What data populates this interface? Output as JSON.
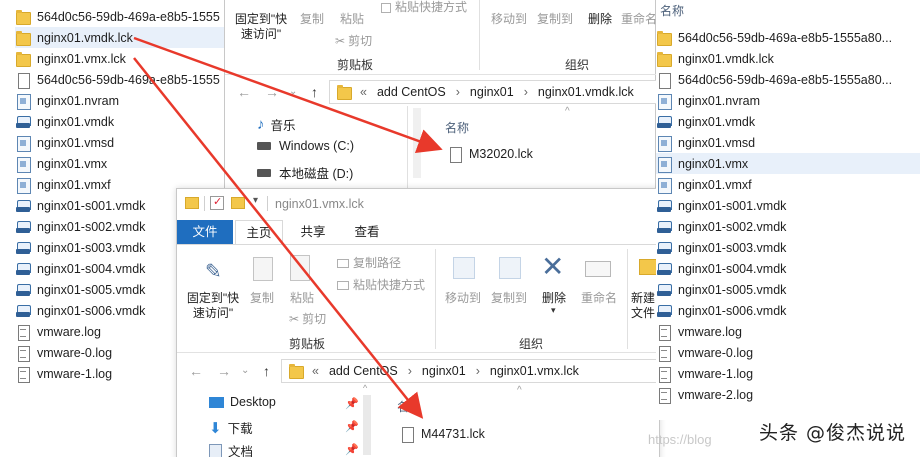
{
  "left_list": [
    {
      "name": "564d0c56-59db-469a-e8b5-1555",
      "icon": "folder"
    },
    {
      "name": "nginx01.vmdk.lck",
      "icon": "folder",
      "selected": true
    },
    {
      "name": "nginx01.vmx.lck",
      "icon": "folder"
    },
    {
      "name": "564d0c56-59db-469a-e8b5-1555",
      "icon": "doc"
    },
    {
      "name": "nginx01.nvram",
      "icon": "vmx"
    },
    {
      "name": "nginx01.vmdk",
      "icon": "disk"
    },
    {
      "name": "nginx01.vmsd",
      "icon": "vmx"
    },
    {
      "name": "nginx01.vmx",
      "icon": "vmx"
    },
    {
      "name": "nginx01.vmxf",
      "icon": "vmx"
    },
    {
      "name": "nginx01-s001.vmdk",
      "icon": "disk"
    },
    {
      "name": "nginx01-s002.vmdk",
      "icon": "disk"
    },
    {
      "name": "nginx01-s003.vmdk",
      "icon": "disk"
    },
    {
      "name": "nginx01-s004.vmdk",
      "icon": "disk"
    },
    {
      "name": "nginx01-s005.vmdk",
      "icon": "disk"
    },
    {
      "name": "nginx01-s006.vmdk",
      "icon": "disk"
    },
    {
      "name": "vmware.log",
      "icon": "docl"
    },
    {
      "name": "vmware-0.log",
      "icon": "docl"
    },
    {
      "name": "vmware-1.log",
      "icon": "docl"
    }
  ],
  "right_list": {
    "header": "名称",
    "items": [
      {
        "name": "564d0c56-59db-469a-e8b5-1555a80...",
        "icon": "folder"
      },
      {
        "name": "nginx01.vmdk.lck",
        "icon": "folder"
      },
      {
        "name": "564d0c56-59db-469a-e8b5-1555a80...",
        "icon": "doc"
      },
      {
        "name": "nginx01.nvram",
        "icon": "vmx"
      },
      {
        "name": "nginx01.vmdk",
        "icon": "disk"
      },
      {
        "name": "nginx01.vmsd",
        "icon": "vmx"
      },
      {
        "name": "nginx01.vmx",
        "icon": "vmx",
        "selected": true
      },
      {
        "name": "nginx01.vmxf",
        "icon": "vmx"
      },
      {
        "name": "nginx01-s001.vmdk",
        "icon": "disk"
      },
      {
        "name": "nginx01-s002.vmdk",
        "icon": "disk"
      },
      {
        "name": "nginx01-s003.vmdk",
        "icon": "disk"
      },
      {
        "name": "nginx01-s004.vmdk",
        "icon": "disk"
      },
      {
        "name": "nginx01-s005.vmdk",
        "icon": "disk"
      },
      {
        "name": "nginx01-s006.vmdk",
        "icon": "disk"
      },
      {
        "name": "vmware.log",
        "icon": "docl"
      },
      {
        "name": "vmware-0.log",
        "icon": "docl"
      },
      {
        "name": "vmware-1.log",
        "icon": "docl"
      },
      {
        "name": "vmware-2.log",
        "icon": "docl"
      }
    ]
  },
  "win1": {
    "ribbon": {
      "pin_label": "固定到\"快\n速访问\"",
      "copy": "复制",
      "paste": "粘贴",
      "paste_shortcut": "粘贴快捷方式",
      "cut": "剪切",
      "clipboard_group": "剪贴板",
      "move_to": "移动到",
      "copy_to": "复制到",
      "delete": "删除",
      "rename": "重命名",
      "organize_group": "组织"
    },
    "address": {
      "prefix": "«",
      "crumbs": [
        "add CentOS",
        "nginx01",
        "nginx01.vmdk.lck"
      ]
    },
    "nav": [
      {
        "label": "音乐",
        "icon": "music-icon"
      },
      {
        "label": "Windows (C:)",
        "icon": "drive-icon"
      },
      {
        "label": "本地磁盘 (D:)",
        "icon": "drive-icon"
      }
    ],
    "col_header": "名称",
    "files": [
      {
        "name": "M32020.lck"
      }
    ]
  },
  "win2": {
    "title": "nginx01.vmx.lck",
    "tabs": {
      "file": "文件",
      "home": "主页",
      "share": "共享",
      "view": "查看"
    },
    "ribbon": {
      "pin_label": "固定到\"快\n速访问\"",
      "copy": "复制",
      "paste": "粘贴",
      "copy_path": "复制路径",
      "paste_shortcut": "粘贴快捷方式",
      "cut": "剪切",
      "clipboard_group": "剪贴板",
      "move_to": "移动到",
      "copy_to": "复制到",
      "delete": "删除",
      "rename": "重命名",
      "organize_group": "组织",
      "new_folder": "新建\n文件"
    },
    "address": {
      "prefix": "«",
      "crumbs": [
        "add CentOS",
        "nginx01",
        "nginx01.vmx.lck"
      ]
    },
    "nav": [
      {
        "label": "Desktop",
        "icon": "desktop-icon"
      },
      {
        "label": "下载",
        "icon": "download-icon"
      },
      {
        "label": "文档",
        "icon": "documents-icon"
      }
    ],
    "col_header": "名",
    "files": [
      {
        "name": "M44731.lck"
      }
    ]
  },
  "watermark": {
    "text": "头条 @俊杰说说",
    "url": "https://blog"
  },
  "colors": {
    "arrow": "#e8392b",
    "file_tab": "#1f6ebf",
    "selected_row": "#e8f0fa"
  }
}
